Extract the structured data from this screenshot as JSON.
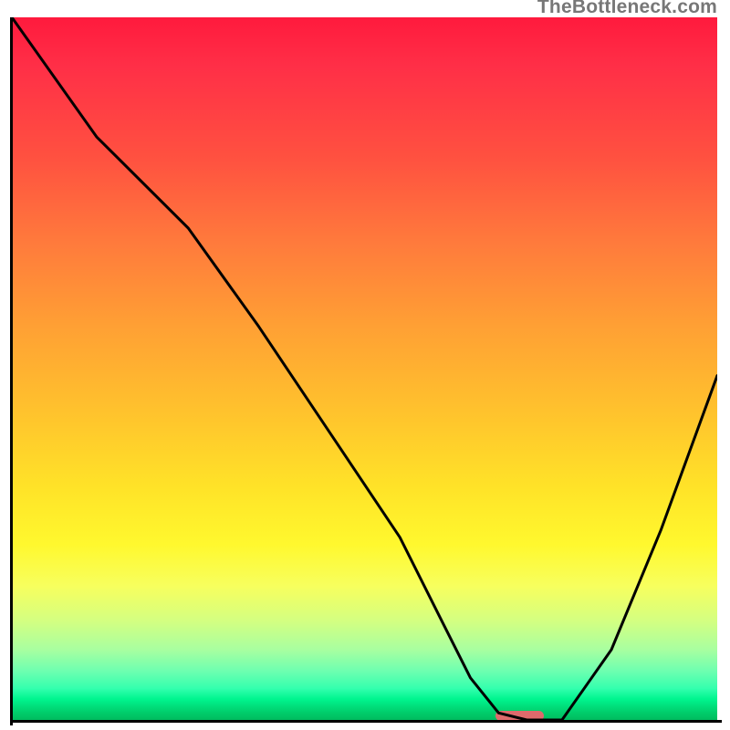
{
  "watermark": "TheBottleneck.com",
  "colors": {
    "axis": "#000000",
    "curve": "#000000",
    "marker": "#de6a6c",
    "gradient_top": "#ff1a3d",
    "gradient_bottom": "#00bb5f"
  },
  "chart_data": {
    "type": "line",
    "title": "",
    "xlabel": "",
    "ylabel": "",
    "xlim": [
      0,
      100
    ],
    "ylim": [
      0,
      100
    ],
    "x": [
      0,
      12,
      25,
      35,
      45,
      55,
      61,
      65,
      69,
      73,
      78,
      85,
      92,
      100
    ],
    "y": [
      100,
      83,
      70,
      56,
      41,
      26,
      14,
      6,
      1,
      0,
      0,
      10,
      27,
      49
    ],
    "marker": {
      "x_start": 69,
      "x_end": 75,
      "y": 0
    },
    "notes": "y=100 is top (red / worst), y=0 is bottom (green / best); marker shows the optimum band on the x-axis"
  }
}
